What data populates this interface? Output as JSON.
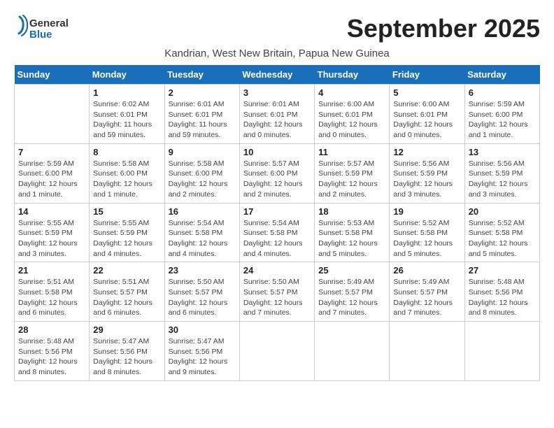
{
  "logo": {
    "general": "General",
    "blue": "Blue"
  },
  "title": "September 2025",
  "subtitle": "Kandrian, West New Britain, Papua New Guinea",
  "days": [
    "Sunday",
    "Monday",
    "Tuesday",
    "Wednesday",
    "Thursday",
    "Friday",
    "Saturday"
  ],
  "weeks": [
    [
      {
        "day": "",
        "sunrise": "",
        "sunset": "",
        "daylight": ""
      },
      {
        "day": "1",
        "sunrise": "Sunrise: 6:02 AM",
        "sunset": "Sunset: 6:01 PM",
        "daylight": "Daylight: 11 hours and 59 minutes."
      },
      {
        "day": "2",
        "sunrise": "Sunrise: 6:01 AM",
        "sunset": "Sunset: 6:01 PM",
        "daylight": "Daylight: 11 hours and 59 minutes."
      },
      {
        "day": "3",
        "sunrise": "Sunrise: 6:01 AM",
        "sunset": "Sunset: 6:01 PM",
        "daylight": "Daylight: 12 hours and 0 minutes."
      },
      {
        "day": "4",
        "sunrise": "Sunrise: 6:00 AM",
        "sunset": "Sunset: 6:01 PM",
        "daylight": "Daylight: 12 hours and 0 minutes."
      },
      {
        "day": "5",
        "sunrise": "Sunrise: 6:00 AM",
        "sunset": "Sunset: 6:01 PM",
        "daylight": "Daylight: 12 hours and 0 minutes."
      },
      {
        "day": "6",
        "sunrise": "Sunrise: 5:59 AM",
        "sunset": "Sunset: 6:00 PM",
        "daylight": "Daylight: 12 hours and 1 minute."
      }
    ],
    [
      {
        "day": "7",
        "sunrise": "Sunrise: 5:59 AM",
        "sunset": "Sunset: 6:00 PM",
        "daylight": "Daylight: 12 hours and 1 minute."
      },
      {
        "day": "8",
        "sunrise": "Sunrise: 5:58 AM",
        "sunset": "Sunset: 6:00 PM",
        "daylight": "Daylight: 12 hours and 1 minute."
      },
      {
        "day": "9",
        "sunrise": "Sunrise: 5:58 AM",
        "sunset": "Sunset: 6:00 PM",
        "daylight": "Daylight: 12 hours and 2 minutes."
      },
      {
        "day": "10",
        "sunrise": "Sunrise: 5:57 AM",
        "sunset": "Sunset: 6:00 PM",
        "daylight": "Daylight: 12 hours and 2 minutes."
      },
      {
        "day": "11",
        "sunrise": "Sunrise: 5:57 AM",
        "sunset": "Sunset: 5:59 PM",
        "daylight": "Daylight: 12 hours and 2 minutes."
      },
      {
        "day": "12",
        "sunrise": "Sunrise: 5:56 AM",
        "sunset": "Sunset: 5:59 PM",
        "daylight": "Daylight: 12 hours and 3 minutes."
      },
      {
        "day": "13",
        "sunrise": "Sunrise: 5:56 AM",
        "sunset": "Sunset: 5:59 PM",
        "daylight": "Daylight: 12 hours and 3 minutes."
      }
    ],
    [
      {
        "day": "14",
        "sunrise": "Sunrise: 5:55 AM",
        "sunset": "Sunset: 5:59 PM",
        "daylight": "Daylight: 12 hours and 3 minutes."
      },
      {
        "day": "15",
        "sunrise": "Sunrise: 5:55 AM",
        "sunset": "Sunset: 5:59 PM",
        "daylight": "Daylight: 12 hours and 4 minutes."
      },
      {
        "day": "16",
        "sunrise": "Sunrise: 5:54 AM",
        "sunset": "Sunset: 5:58 PM",
        "daylight": "Daylight: 12 hours and 4 minutes."
      },
      {
        "day": "17",
        "sunrise": "Sunrise: 5:54 AM",
        "sunset": "Sunset: 5:58 PM",
        "daylight": "Daylight: 12 hours and 4 minutes."
      },
      {
        "day": "18",
        "sunrise": "Sunrise: 5:53 AM",
        "sunset": "Sunset: 5:58 PM",
        "daylight": "Daylight: 12 hours and 5 minutes."
      },
      {
        "day": "19",
        "sunrise": "Sunrise: 5:52 AM",
        "sunset": "Sunset: 5:58 PM",
        "daylight": "Daylight: 12 hours and 5 minutes."
      },
      {
        "day": "20",
        "sunrise": "Sunrise: 5:52 AM",
        "sunset": "Sunset: 5:58 PM",
        "daylight": "Daylight: 12 hours and 5 minutes."
      }
    ],
    [
      {
        "day": "21",
        "sunrise": "Sunrise: 5:51 AM",
        "sunset": "Sunset: 5:58 PM",
        "daylight": "Daylight: 12 hours and 6 minutes."
      },
      {
        "day": "22",
        "sunrise": "Sunrise: 5:51 AM",
        "sunset": "Sunset: 5:57 PM",
        "daylight": "Daylight: 12 hours and 6 minutes."
      },
      {
        "day": "23",
        "sunrise": "Sunrise: 5:50 AM",
        "sunset": "Sunset: 5:57 PM",
        "daylight": "Daylight: 12 hours and 6 minutes."
      },
      {
        "day": "24",
        "sunrise": "Sunrise: 5:50 AM",
        "sunset": "Sunset: 5:57 PM",
        "daylight": "Daylight: 12 hours and 7 minutes."
      },
      {
        "day": "25",
        "sunrise": "Sunrise: 5:49 AM",
        "sunset": "Sunset: 5:57 PM",
        "daylight": "Daylight: 12 hours and 7 minutes."
      },
      {
        "day": "26",
        "sunrise": "Sunrise: 5:49 AM",
        "sunset": "Sunset: 5:57 PM",
        "daylight": "Daylight: 12 hours and 7 minutes."
      },
      {
        "day": "27",
        "sunrise": "Sunrise: 5:48 AM",
        "sunset": "Sunset: 5:56 PM",
        "daylight": "Daylight: 12 hours and 8 minutes."
      }
    ],
    [
      {
        "day": "28",
        "sunrise": "Sunrise: 5:48 AM",
        "sunset": "Sunset: 5:56 PM",
        "daylight": "Daylight: 12 hours and 8 minutes."
      },
      {
        "day": "29",
        "sunrise": "Sunrise: 5:47 AM",
        "sunset": "Sunset: 5:56 PM",
        "daylight": "Daylight: 12 hours and 8 minutes."
      },
      {
        "day": "30",
        "sunrise": "Sunrise: 5:47 AM",
        "sunset": "Sunset: 5:56 PM",
        "daylight": "Daylight: 12 hours and 9 minutes."
      },
      {
        "day": "",
        "sunrise": "",
        "sunset": "",
        "daylight": ""
      },
      {
        "day": "",
        "sunrise": "",
        "sunset": "",
        "daylight": ""
      },
      {
        "day": "",
        "sunrise": "",
        "sunset": "",
        "daylight": ""
      },
      {
        "day": "",
        "sunrise": "",
        "sunset": "",
        "daylight": ""
      }
    ]
  ]
}
